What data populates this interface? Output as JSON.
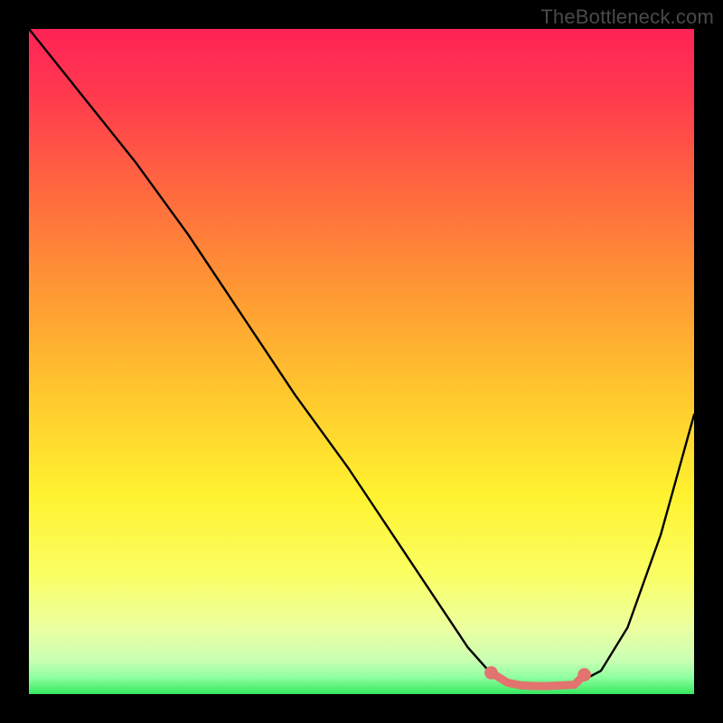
{
  "watermark": "TheBottleneck.com",
  "gradient_stops": [
    {
      "offset": 0.0,
      "color": "#ff2356"
    },
    {
      "offset": 0.1,
      "color": "#ff3a4e"
    },
    {
      "offset": 0.25,
      "color": "#ff6b3e"
    },
    {
      "offset": 0.4,
      "color": "#ff9a33"
    },
    {
      "offset": 0.55,
      "color": "#ffc82e"
    },
    {
      "offset": 0.7,
      "color": "#fff22f"
    },
    {
      "offset": 0.82,
      "color": "#faff63"
    },
    {
      "offset": 0.9,
      "color": "#ecffa0"
    },
    {
      "offset": 0.95,
      "color": "#c9ffb3"
    },
    {
      "offset": 0.975,
      "color": "#8fff9f"
    },
    {
      "offset": 1.0,
      "color": "#36e85e"
    }
  ],
  "chart_data": {
    "type": "line",
    "title": "",
    "xlabel": "",
    "ylabel": "",
    "xlim": [
      0,
      100
    ],
    "ylim": [
      0,
      100
    ],
    "series": [
      {
        "name": "bottleneck-curve",
        "color": "#000000",
        "x": [
          0,
          8,
          16,
          24,
          32,
          40,
          48,
          56,
          62,
          66,
          70,
          74,
          78,
          82,
          86,
          90,
          95,
          100
        ],
        "values": [
          100,
          90,
          80,
          69,
          57,
          45,
          34,
          22,
          13,
          7,
          2.5,
          1.3,
          1.2,
          1.4,
          3.5,
          10,
          24,
          42
        ]
      },
      {
        "name": "optimal-band",
        "color": "#e2736f",
        "x": [
          69.5,
          72,
          74,
          76,
          78,
          80,
          82,
          83.5
        ],
        "values": [
          3.2,
          1.7,
          1.3,
          1.2,
          1.2,
          1.3,
          1.4,
          2.9
        ]
      }
    ],
    "markers": [
      {
        "name": "band-start-dot",
        "x": 69.5,
        "y": 3.2,
        "color": "#e2736f",
        "r": 1.0
      },
      {
        "name": "band-end-dot",
        "x": 83.5,
        "y": 2.9,
        "color": "#e2736f",
        "r": 1.0
      }
    ]
  }
}
